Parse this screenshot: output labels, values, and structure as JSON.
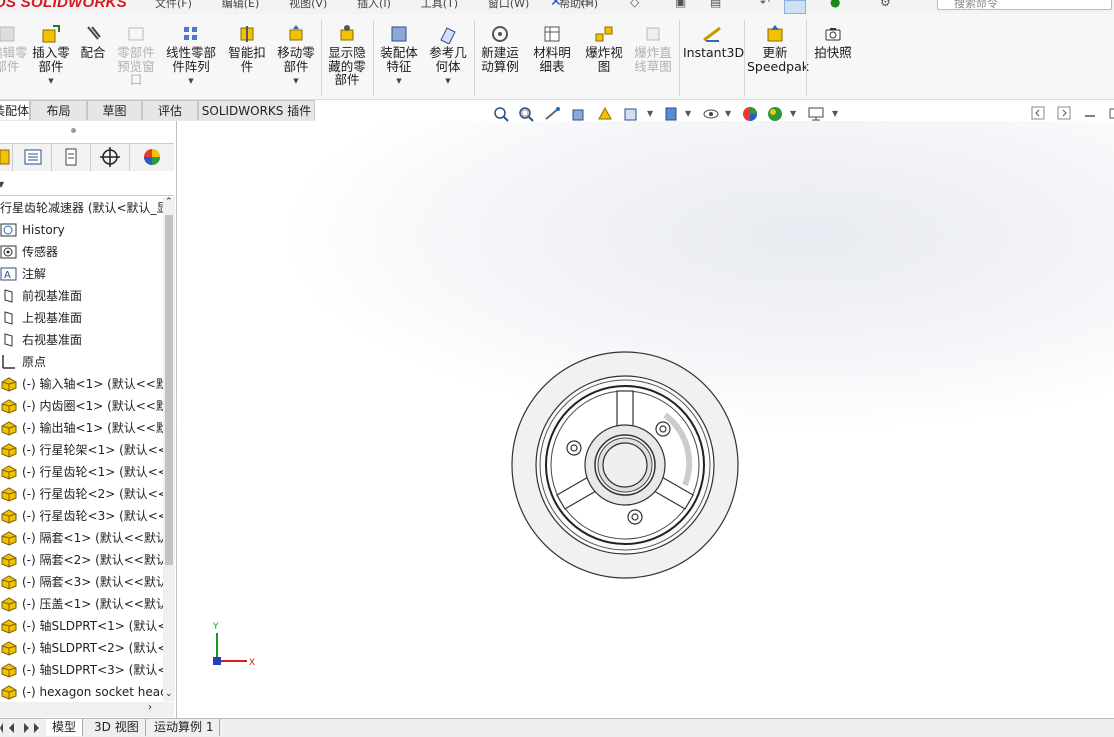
{
  "app": {
    "brand": "OS SOLIDWORKS",
    "menus": [
      "文件(F)",
      "编辑(E)",
      "视图(V)",
      "插入(I)",
      "工具(T)",
      "窗口(W)",
      "帮助(H)"
    ],
    "search_placeholder": "搜索命令"
  },
  "toolbar": {
    "items": [
      {
        "label": "编辑零\n部件",
        "icon": "edit-component-icon",
        "enabled": false
      },
      {
        "label": "插入零\n部件",
        "icon": "insert-component-icon",
        "enabled": true,
        "dropdown": true
      },
      {
        "label": "配合",
        "icon": "mate-icon",
        "enabled": true
      },
      {
        "label": "零部件\n预览窗\n口",
        "icon": "preview-window-icon",
        "enabled": false
      },
      {
        "label": "线性零部\n件阵列",
        "icon": "linear-pattern-icon",
        "enabled": true,
        "dropdown": true
      },
      {
        "label": "智能扣\n件",
        "icon": "smart-fastener-icon",
        "enabled": true
      },
      {
        "label": "移动零\n部件",
        "icon": "move-component-icon",
        "enabled": true,
        "dropdown": true
      },
      {
        "label": "显示隐\n藏的零\n部件",
        "icon": "show-hidden-icon",
        "enabled": true
      },
      {
        "label": "装配体\n特征",
        "icon": "assembly-feature-icon",
        "enabled": true,
        "dropdown": true
      },
      {
        "label": "参考几\n何体",
        "icon": "reference-geometry-icon",
        "enabled": true,
        "dropdown": true
      },
      {
        "label": "新建运\n动算例",
        "icon": "motion-study-icon",
        "enabled": true
      },
      {
        "label": "材料明\n细表",
        "icon": "bom-icon",
        "enabled": true
      },
      {
        "label": "爆炸视\n图",
        "icon": "exploded-view-icon",
        "enabled": true
      },
      {
        "label": "爆炸直\n线草图",
        "icon": "explode-line-icon",
        "enabled": false
      },
      {
        "label": "Instant3D",
        "icon": "instant3d-icon",
        "enabled": true
      },
      {
        "label": "更新\nSpeedpak",
        "icon": "speedpak-icon",
        "enabled": true
      },
      {
        "label": "拍快照",
        "icon": "camera-icon",
        "enabled": true
      }
    ]
  },
  "tabs": [
    "装配体",
    "布局",
    "草图",
    "评估",
    "SOLIDWORKS 插件"
  ],
  "active_tab": "装配体",
  "tree": {
    "root": "行星齿轮减速器  (默认<默认_显",
    "items": [
      {
        "label": "History",
        "icon": "history-icon"
      },
      {
        "label": "传感器",
        "icon": "sensor-icon"
      },
      {
        "label": "注解",
        "icon": "annotation-icon"
      },
      {
        "label": "前视基准面",
        "icon": "plane-icon"
      },
      {
        "label": "上视基准面",
        "icon": "plane-icon"
      },
      {
        "label": "右视基准面",
        "icon": "plane-icon"
      },
      {
        "label": "原点",
        "icon": "origin-icon"
      },
      {
        "label": "(-) 输入轴<1> (默认<<默",
        "icon": "part-icon"
      },
      {
        "label": "(-) 内齿圈<1> (默认<<默",
        "icon": "part-icon"
      },
      {
        "label": "(-) 输出轴<1> (默认<<默",
        "icon": "part-icon"
      },
      {
        "label": "(-) 行星轮架<1> (默认<<",
        "icon": "part-icon"
      },
      {
        "label": "(-) 行星齿轮<1> (默认<<",
        "icon": "part-icon"
      },
      {
        "label": "(-) 行星齿轮<2> (默认<<",
        "icon": "part-icon"
      },
      {
        "label": "(-) 行星齿轮<3> (默认<<",
        "icon": "part-icon"
      },
      {
        "label": "(-) 隔套<1> (默认<<默认",
        "icon": "part-icon"
      },
      {
        "label": "(-) 隔套<2> (默认<<默认",
        "icon": "part-icon"
      },
      {
        "label": "(-) 隔套<3> (默认<<默认",
        "icon": "part-icon"
      },
      {
        "label": "(-) 压盖<1> (默认<<默认",
        "icon": "part-icon"
      },
      {
        "label": "(-) 轴SLDPRT<1> (默认<",
        "icon": "part-icon"
      },
      {
        "label": "(-) 轴SLDPRT<2> (默认<",
        "icon": "part-icon"
      },
      {
        "label": "(-) 轴SLDPRT<3> (默认<",
        "icon": "part-icon"
      },
      {
        "label": "(-) hexagon socket heac",
        "icon": "part-icon"
      }
    ]
  },
  "triad": {
    "x": "X",
    "y": "Y"
  },
  "bottom_tabs": [
    "模型",
    "3D 视图",
    "运动算例 1"
  ],
  "colors": {
    "brand": "#d71920",
    "part_icon": "#f2c200",
    "axis_x": "#d62020",
    "axis_y": "#1a9a1a",
    "axis_z": "#2040c0"
  }
}
